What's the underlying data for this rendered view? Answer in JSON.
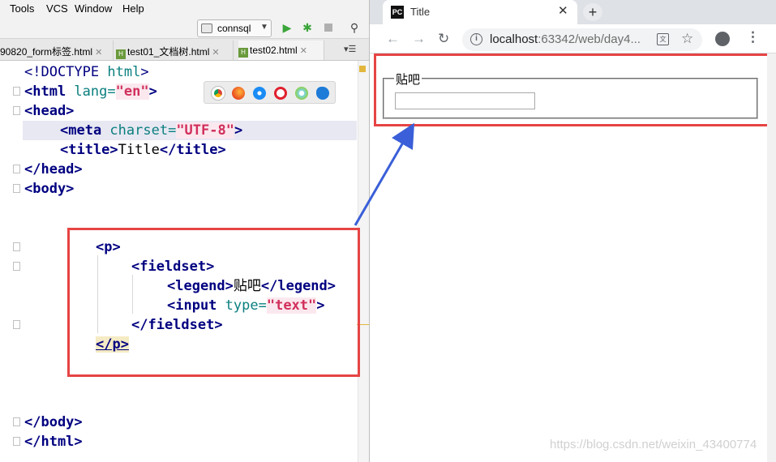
{
  "menubar": {
    "items": [
      "Tools",
      "VCS",
      "Window",
      "Help"
    ]
  },
  "toolbar": {
    "run_config": "connsql"
  },
  "editor_tabs": [
    {
      "label": "90820_form标签.html"
    },
    {
      "label": "test01_文档树.html"
    },
    {
      "label": "test02.html"
    }
  ],
  "code": {
    "doctype_open": "<!DOCTYPE ",
    "doctype_kw": "html",
    "doctype_close": ">",
    "html_open": "<html",
    "lang_attr": " lang=",
    "lang_val": "\"en\"",
    "gt": ">",
    "head_open": "<head>",
    "meta_open": "<meta",
    "charset_attr": " charset=",
    "charset_val": "\"UTF-8\"",
    "title_open": "<title>",
    "title_text": "Title",
    "title_close": "</title>",
    "head_close": "</head>",
    "body_open": "<body>",
    "p_open": "<p>",
    "fieldset_open": "<fieldset>",
    "legend_open": "<legend>",
    "legend_text": "贴吧",
    "legend_close": "</legend>",
    "input_open": "<input",
    "type_attr": " type=",
    "type_val": "\"text\"",
    "fieldset_close": "</fieldset>",
    "p_close": "</p>",
    "body_close": "</body>",
    "html_close": "</html>"
  },
  "browser": {
    "tab_title": "Title",
    "tab_icon_label": "PC",
    "url_host": "localhost",
    "url_rest": ":63342/web/day4...",
    "page": {
      "legend": "贴吧",
      "input_value": ""
    }
  },
  "colors": {
    "highlight_border": "#e64444",
    "arrow": "#3a5fd8"
  },
  "watermark": "https://blog.csdn.net/weixin_43400774"
}
